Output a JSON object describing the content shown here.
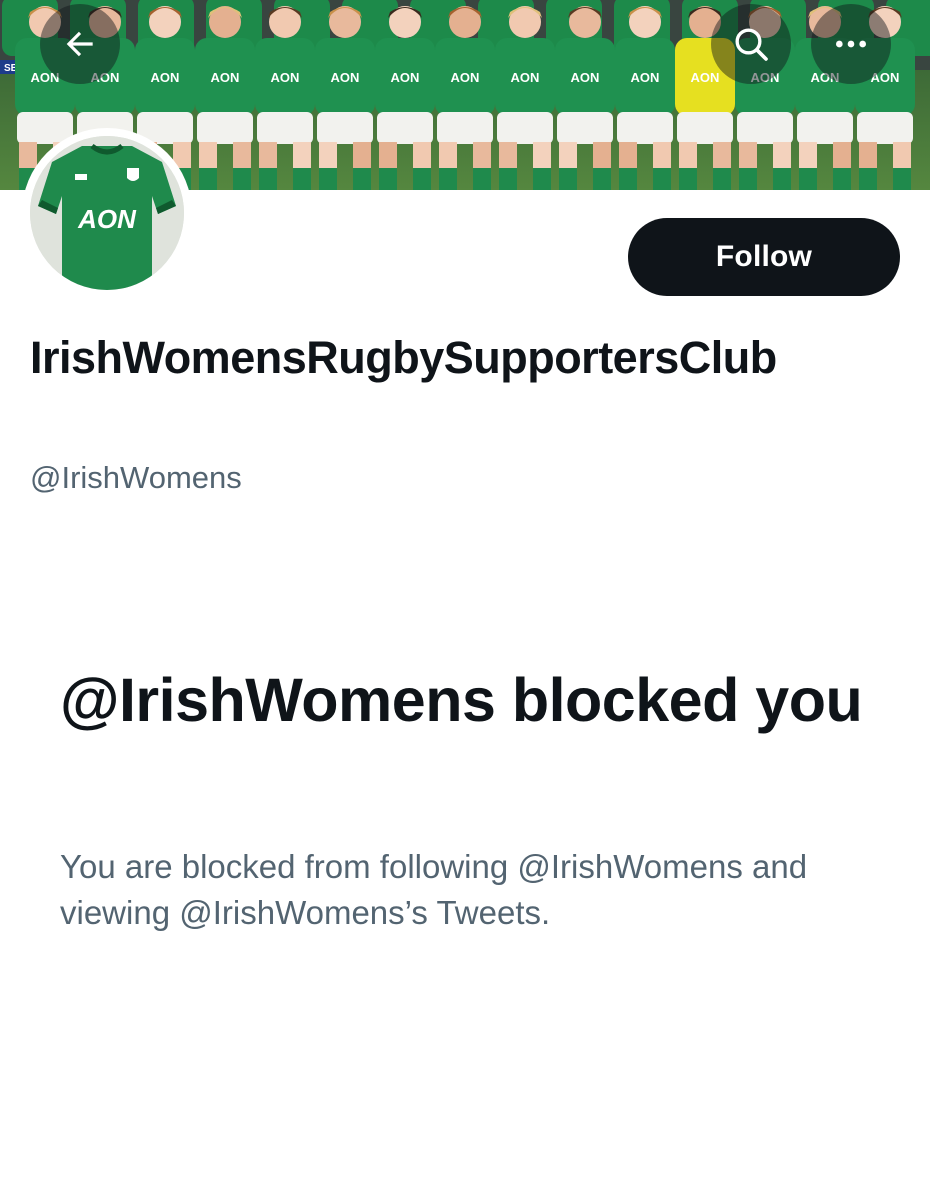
{
  "profile": {
    "display_name": "IrishWomensRugbySupportersClub",
    "handle": "@IrishWomens",
    "follow_label": "Follow"
  },
  "banner": {
    "jersey_text": "AON",
    "board_text": "SEINA"
  },
  "avatar": {
    "jersey_text": "AON"
  },
  "blocked": {
    "title": "@IrishWomens blocked you",
    "body": "You are blocked from following @IrishWomens and viewing @IrishWomens’s Tweets."
  },
  "icons": {
    "back": "arrow-left-icon",
    "search": "search-icon",
    "more": "more-icon"
  },
  "colors": {
    "follow_bg": "#0f1419",
    "secondary_text": "#536471",
    "jersey_green": "#1f8a4c"
  }
}
